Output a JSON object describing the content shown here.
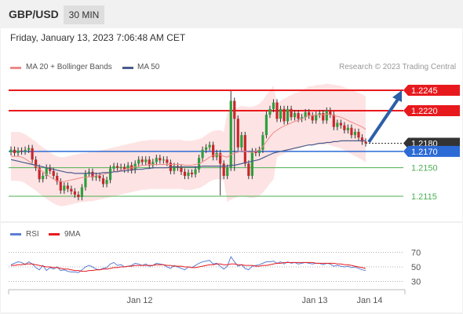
{
  "header": {
    "symbol": "GBP/USD",
    "timeframe": "30 MIN",
    "datetime": "Friday, January 13, 2023 7:06:48 AM CET"
  },
  "legend": {
    "ma20": "MA 20 + Bollinger Bands",
    "ma50": "MA 50",
    "credit": "Research © 2023 Trading Central"
  },
  "rsi_legend": {
    "rsi": "RSI",
    "ma": "9MA"
  },
  "colors": {
    "resistance": "#e8191d",
    "current": "#333333",
    "pivot": "#2c6ad6",
    "support": "#4caf50",
    "ma20": "#ee8a8a",
    "ma50": "#4a5b8c",
    "bands": "#fde3e3",
    "up": "#2e9e3d",
    "down": "#c7262a",
    "arrow": "#2c5fa8"
  },
  "chart_data": [
    {
      "type": "line",
      "name": "price",
      "ylim": [
        1.2095,
        1.226
      ],
      "xlabels": [
        "Jan 12",
        "Jan 13",
        "Jan 14"
      ],
      "levels": [
        {
          "label": "1.2245",
          "value": 1.2245,
          "kind": "resistance"
        },
        {
          "label": "1.2220",
          "value": 1.222,
          "kind": "resistance"
        },
        {
          "label": "1.2180",
          "value": 1.218,
          "kind": "current"
        },
        {
          "label": "1.2170",
          "value": 1.217,
          "kind": "pivot"
        },
        {
          "label": "1.2150",
          "value": 1.215,
          "kind": "support"
        },
        {
          "label": "1.2115",
          "value": 1.2115,
          "kind": "support"
        }
      ],
      "close": [
        1.2172,
        1.2168,
        1.2171,
        1.217,
        1.2172,
        1.2174,
        1.216,
        1.215,
        1.2136,
        1.214,
        1.215,
        1.2146,
        1.214,
        1.2133,
        1.2122,
        1.2128,
        1.2124,
        1.2121,
        1.2117,
        1.2114,
        1.2126,
        1.2143,
        1.2145,
        1.2138,
        1.214,
        1.2137,
        1.213,
        1.2135,
        1.2149,
        1.2152,
        1.215,
        1.2151,
        1.2148,
        1.2153,
        1.2147,
        1.2155,
        1.216,
        1.2157,
        1.216,
        1.2153,
        1.2157,
        1.2162,
        1.2159,
        1.216,
        1.2156,
        1.2146,
        1.2152,
        1.215,
        1.2145,
        1.214,
        1.2144,
        1.2142,
        1.2148,
        1.2162,
        1.2172,
        1.2175,
        1.2178,
        1.2163,
        1.2168,
        1.2155,
        1.214,
        1.215,
        1.2232,
        1.221,
        1.2175,
        1.219,
        1.2155,
        1.214,
        1.217,
        1.2168,
        1.2172,
        1.219,
        1.2215,
        1.2222,
        1.223,
        1.221,
        1.2222,
        1.2207,
        1.2222,
        1.2212,
        1.2217,
        1.221,
        1.2212,
        1.2218,
        1.2214,
        1.2208,
        1.2215,
        1.2217,
        1.2208,
        1.222,
        1.2215,
        1.22,
        1.2205,
        1.2202,
        1.2196,
        1.2199,
        1.219,
        1.2194,
        1.2187,
        1.2182,
        1.218
      ],
      "ma20": [
        1.2164,
        1.2164,
        1.2164,
        1.2163,
        1.2161,
        1.2158,
        1.2155,
        1.2152,
        1.2148,
        1.2145,
        1.2142,
        1.2139,
        1.2136,
        1.2134,
        1.2133,
        1.2133,
        1.2134,
        1.2135,
        1.2136,
        1.2137,
        1.2138,
        1.2138,
        1.2139,
        1.2139,
        1.214,
        1.2141,
        1.2142,
        1.2143,
        1.2144,
        1.2145,
        1.2146,
        1.2147,
        1.2148,
        1.2149,
        1.215,
        1.2151,
        1.2152,
        1.2153,
        1.2153,
        1.2154,
        1.2154,
        1.2154,
        1.2154,
        1.2154,
        1.2154,
        1.2154,
        1.2154,
        1.2154,
        1.2154,
        1.2153,
        1.2153,
        1.2153,
        1.2154,
        1.2155,
        1.2157,
        1.216,
        1.2163,
        1.2165,
        1.2166,
        1.2166,
        1.2164,
        1.2163,
        1.2166,
        1.2168,
        1.2169,
        1.2171,
        1.217,
        1.2169,
        1.2169,
        1.217,
        1.2172,
        1.2176,
        1.2182,
        1.2188,
        1.2193,
        1.2196,
        1.2199,
        1.2201,
        1.2203,
        1.2205,
        1.2207,
        1.2208,
        1.221,
        1.2212,
        1.2214,
        1.2214,
        1.2215,
        1.2215,
        1.2215,
        1.2216,
        1.2215,
        1.2214,
        1.2213,
        1.2212,
        1.221,
        1.2208,
        1.2206,
        1.2204,
        1.2202,
        1.22,
        1.2197
      ],
      "ma50": [
        1.216,
        1.2159,
        1.2158,
        1.2157,
        1.2156,
        1.2155,
        1.2154,
        1.2153,
        1.2152,
        1.2151,
        1.215,
        1.2149,
        1.2148,
        1.2147,
        1.2146,
        1.2145,
        1.2144,
        1.2144,
        1.2143,
        1.2143,
        1.2143,
        1.2143,
        1.2143,
        1.2143,
        1.2143,
        1.2143,
        1.2144,
        1.2144,
        1.2144,
        1.2145,
        1.2145,
        1.2146,
        1.2146,
        1.2147,
        1.2147,
        1.2148,
        1.2148,
        1.2148,
        1.2149,
        1.2149,
        1.215,
        1.215,
        1.215,
        1.215,
        1.215,
        1.2151,
        1.2151,
        1.2151,
        1.2151,
        1.2151,
        1.2151,
        1.2151,
        1.2151,
        1.2151,
        1.2152,
        1.2152,
        1.2152,
        1.2152,
        1.2152,
        1.2152,
        1.2152,
        1.2152,
        1.2153,
        1.2153,
        1.2154,
        1.2155,
        1.2156,
        1.2157,
        1.2158,
        1.2159,
        1.216,
        1.2162,
        1.2164,
        1.2166,
        1.2168,
        1.2169,
        1.217,
        1.2171,
        1.2172,
        1.2173,
        1.2174,
        1.2175,
        1.2176,
        1.2177,
        1.2178,
        1.2178,
        1.2179,
        1.218,
        1.218,
        1.2181,
        1.2181,
        1.2182,
        1.2182,
        1.2183,
        1.2183,
        1.2183,
        1.2183,
        1.2183,
        1.2183,
        1.2183,
        1.2183
      ]
    },
    {
      "type": "line",
      "name": "rsi",
      "ylim": [
        25,
        75
      ],
      "yticks": [
        "70",
        "50",
        "30"
      ],
      "rsi": [
        53,
        55,
        57,
        56,
        53,
        57,
        54,
        49,
        46,
        52,
        45,
        49,
        47,
        50,
        45,
        46,
        44,
        43,
        43,
        42,
        46,
        50,
        52,
        50,
        47,
        46,
        48,
        49,
        54,
        56,
        52,
        53,
        50,
        51,
        52,
        55,
        54,
        52,
        54,
        51,
        52,
        55,
        54,
        53,
        50,
        48,
        52,
        50,
        48,
        46,
        50,
        49,
        52,
        55,
        57,
        58,
        59,
        54,
        55,
        51,
        47,
        51,
        64,
        57,
        51,
        53,
        48,
        46,
        51,
        52,
        53,
        55,
        57,
        57,
        58,
        55,
        57,
        54,
        57,
        55,
        56,
        54,
        55,
        56,
        55,
        54,
        55,
        55,
        53,
        55,
        54,
        51,
        52,
        51,
        50,
        51,
        49,
        50,
        48,
        46,
        45
      ],
      "ma9": [
        52,
        52,
        53,
        53,
        54,
        54,
        54,
        53,
        52,
        51,
        50,
        50,
        49,
        49,
        48,
        47,
        47,
        46,
        45,
        45,
        44,
        44,
        45,
        45,
        46,
        46,
        47,
        47,
        48,
        49,
        49,
        50,
        50,
        51,
        51,
        52,
        52,
        52,
        52,
        52,
        52,
        53,
        53,
        53,
        52,
        52,
        51,
        51,
        51,
        50,
        50,
        49,
        49,
        50,
        51,
        52,
        53,
        53,
        54,
        54,
        53,
        53,
        54,
        54,
        53,
        53,
        52,
        52,
        52,
        51,
        51,
        52,
        52,
        53,
        54,
        55,
        55,
        56,
        56,
        56,
        56,
        56,
        56,
        56,
        56,
        56,
        55,
        55,
        55,
        55,
        55,
        55,
        54,
        54,
        53,
        53,
        52,
        51,
        50,
        49,
        48
      ]
    }
  ]
}
